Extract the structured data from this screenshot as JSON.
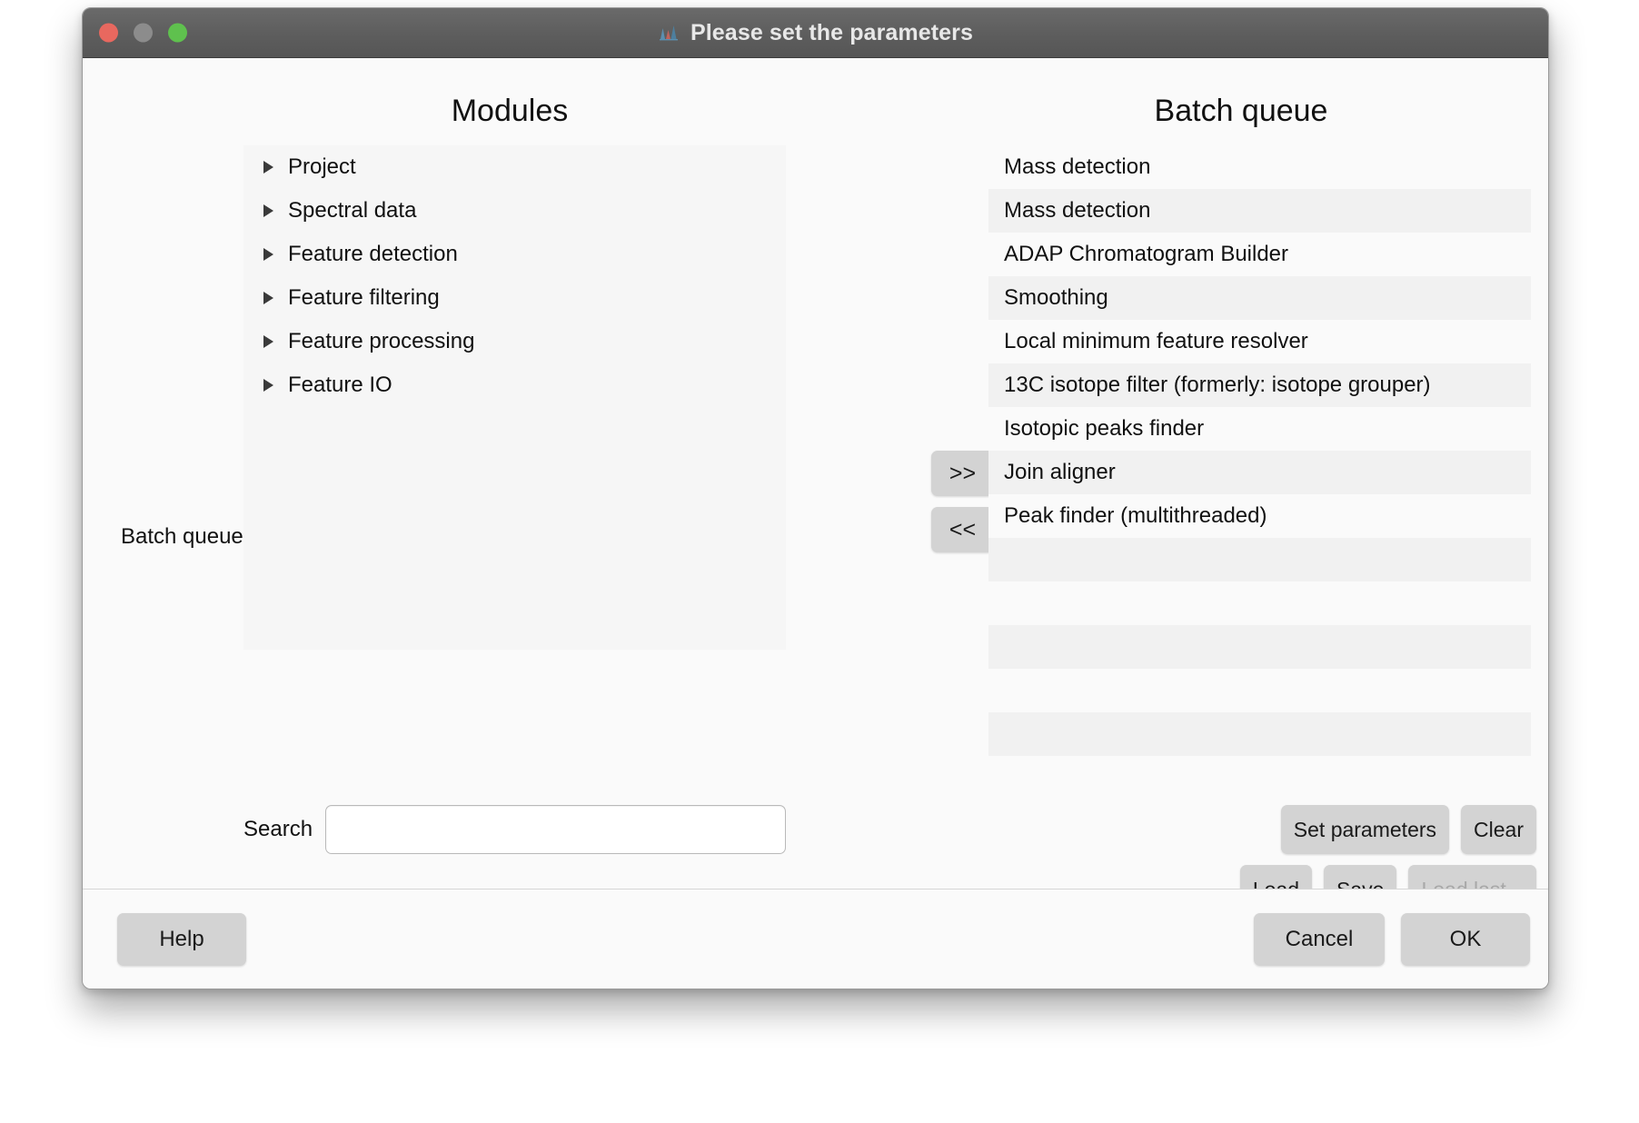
{
  "window": {
    "title": "Please set the parameters",
    "icon": "mzmine-peaks-icon",
    "traffic_lights": [
      "close-red",
      "minimize-gray",
      "zoom-green"
    ],
    "colors": {
      "titlebar": "#5d5d5d",
      "close": "#e8685f",
      "minimize": "#8c8c8c",
      "zoom": "#5fc14e",
      "button": "#d3d3d3",
      "row_alt": "#f1f1f1",
      "panel": "#f6f6f6"
    }
  },
  "modules": {
    "title": "Modules",
    "left_caption": "Batch queue",
    "items": [
      {
        "label": "Project"
      },
      {
        "label": "Spectral data"
      },
      {
        "label": "Feature detection"
      },
      {
        "label": "Feature filtering"
      },
      {
        "label": "Feature processing"
      },
      {
        "label": "Feature IO"
      }
    ],
    "search": {
      "label": "Search",
      "value": "",
      "placeholder": ""
    }
  },
  "transfer": {
    "add_label": ">>",
    "remove_label": "<<"
  },
  "queue": {
    "title": "Batch queue",
    "items": [
      {
        "label": "Mass detection"
      },
      {
        "label": "Mass detection"
      },
      {
        "label": "ADAP Chromatogram Builder"
      },
      {
        "label": "Smoothing"
      },
      {
        "label": "Local minimum feature resolver"
      },
      {
        "label": "13C isotope filter (formerly: isotope grouper)"
      },
      {
        "label": "Isotopic peaks finder"
      },
      {
        "label": "Join aligner"
      },
      {
        "label": "Peak finder (multithreaded)"
      },
      {
        "label": ""
      },
      {
        "label": ""
      },
      {
        "label": ""
      },
      {
        "label": ""
      },
      {
        "label": ""
      }
    ],
    "actions": {
      "set_parameters": "Set parameters",
      "clear": "Clear",
      "load": "Load",
      "save": "Save",
      "load_last": "Load last...",
      "load_last_enabled": false
    }
  },
  "footer": {
    "help": "Help",
    "cancel": "Cancel",
    "ok": "OK"
  }
}
